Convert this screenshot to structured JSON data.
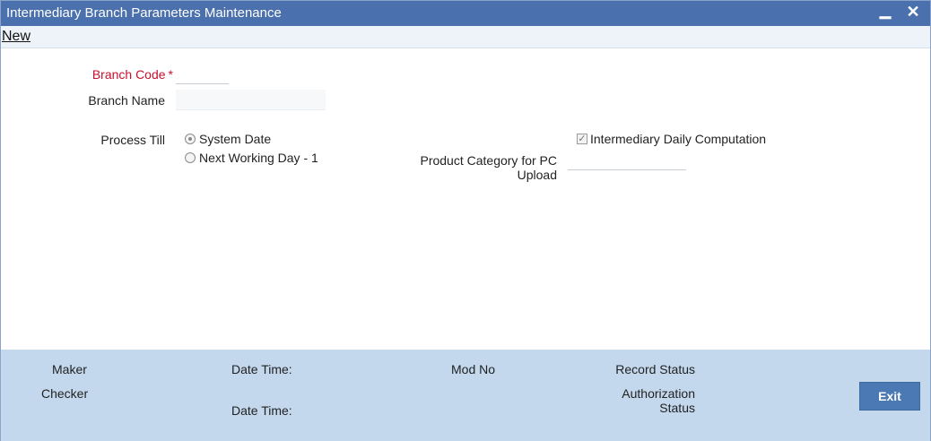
{
  "window": {
    "title": "Intermediary Branch Parameters Maintenance",
    "minimize_glyph": "▁",
    "close_glyph": "✕"
  },
  "menu": {
    "new_label": "New"
  },
  "form": {
    "branch_code": {
      "label": "Branch Code",
      "required_mark": "*",
      "value": ""
    },
    "branch_name": {
      "label": "Branch Name",
      "value": ""
    },
    "process_till": {
      "label": "Process Till",
      "options": [
        {
          "label": "System Date",
          "selected": true
        },
        {
          "label": "Next Working Day - 1",
          "selected": false
        }
      ]
    },
    "intermediary_daily_computation": {
      "label": "Intermediary Daily Computation",
      "checked": true,
      "check_glyph": "✓"
    },
    "product_category": {
      "label_line1": "Product Category for PC",
      "label_line2": "Upload",
      "value": ""
    }
  },
  "footer": {
    "maker": "Maker",
    "checker": "Checker",
    "date_time_1": "Date Time:",
    "date_time_2": "Date Time:",
    "mod_no": "Mod No",
    "record_status": "Record Status",
    "authorization_line1": "Authorization",
    "authorization_line2": "Status",
    "exit_label": "Exit"
  },
  "colors": {
    "titlebar": "#4a70ad",
    "required": "#c8102e",
    "footer": "#c3d8ed",
    "exit_button": "#4a79b4"
  }
}
